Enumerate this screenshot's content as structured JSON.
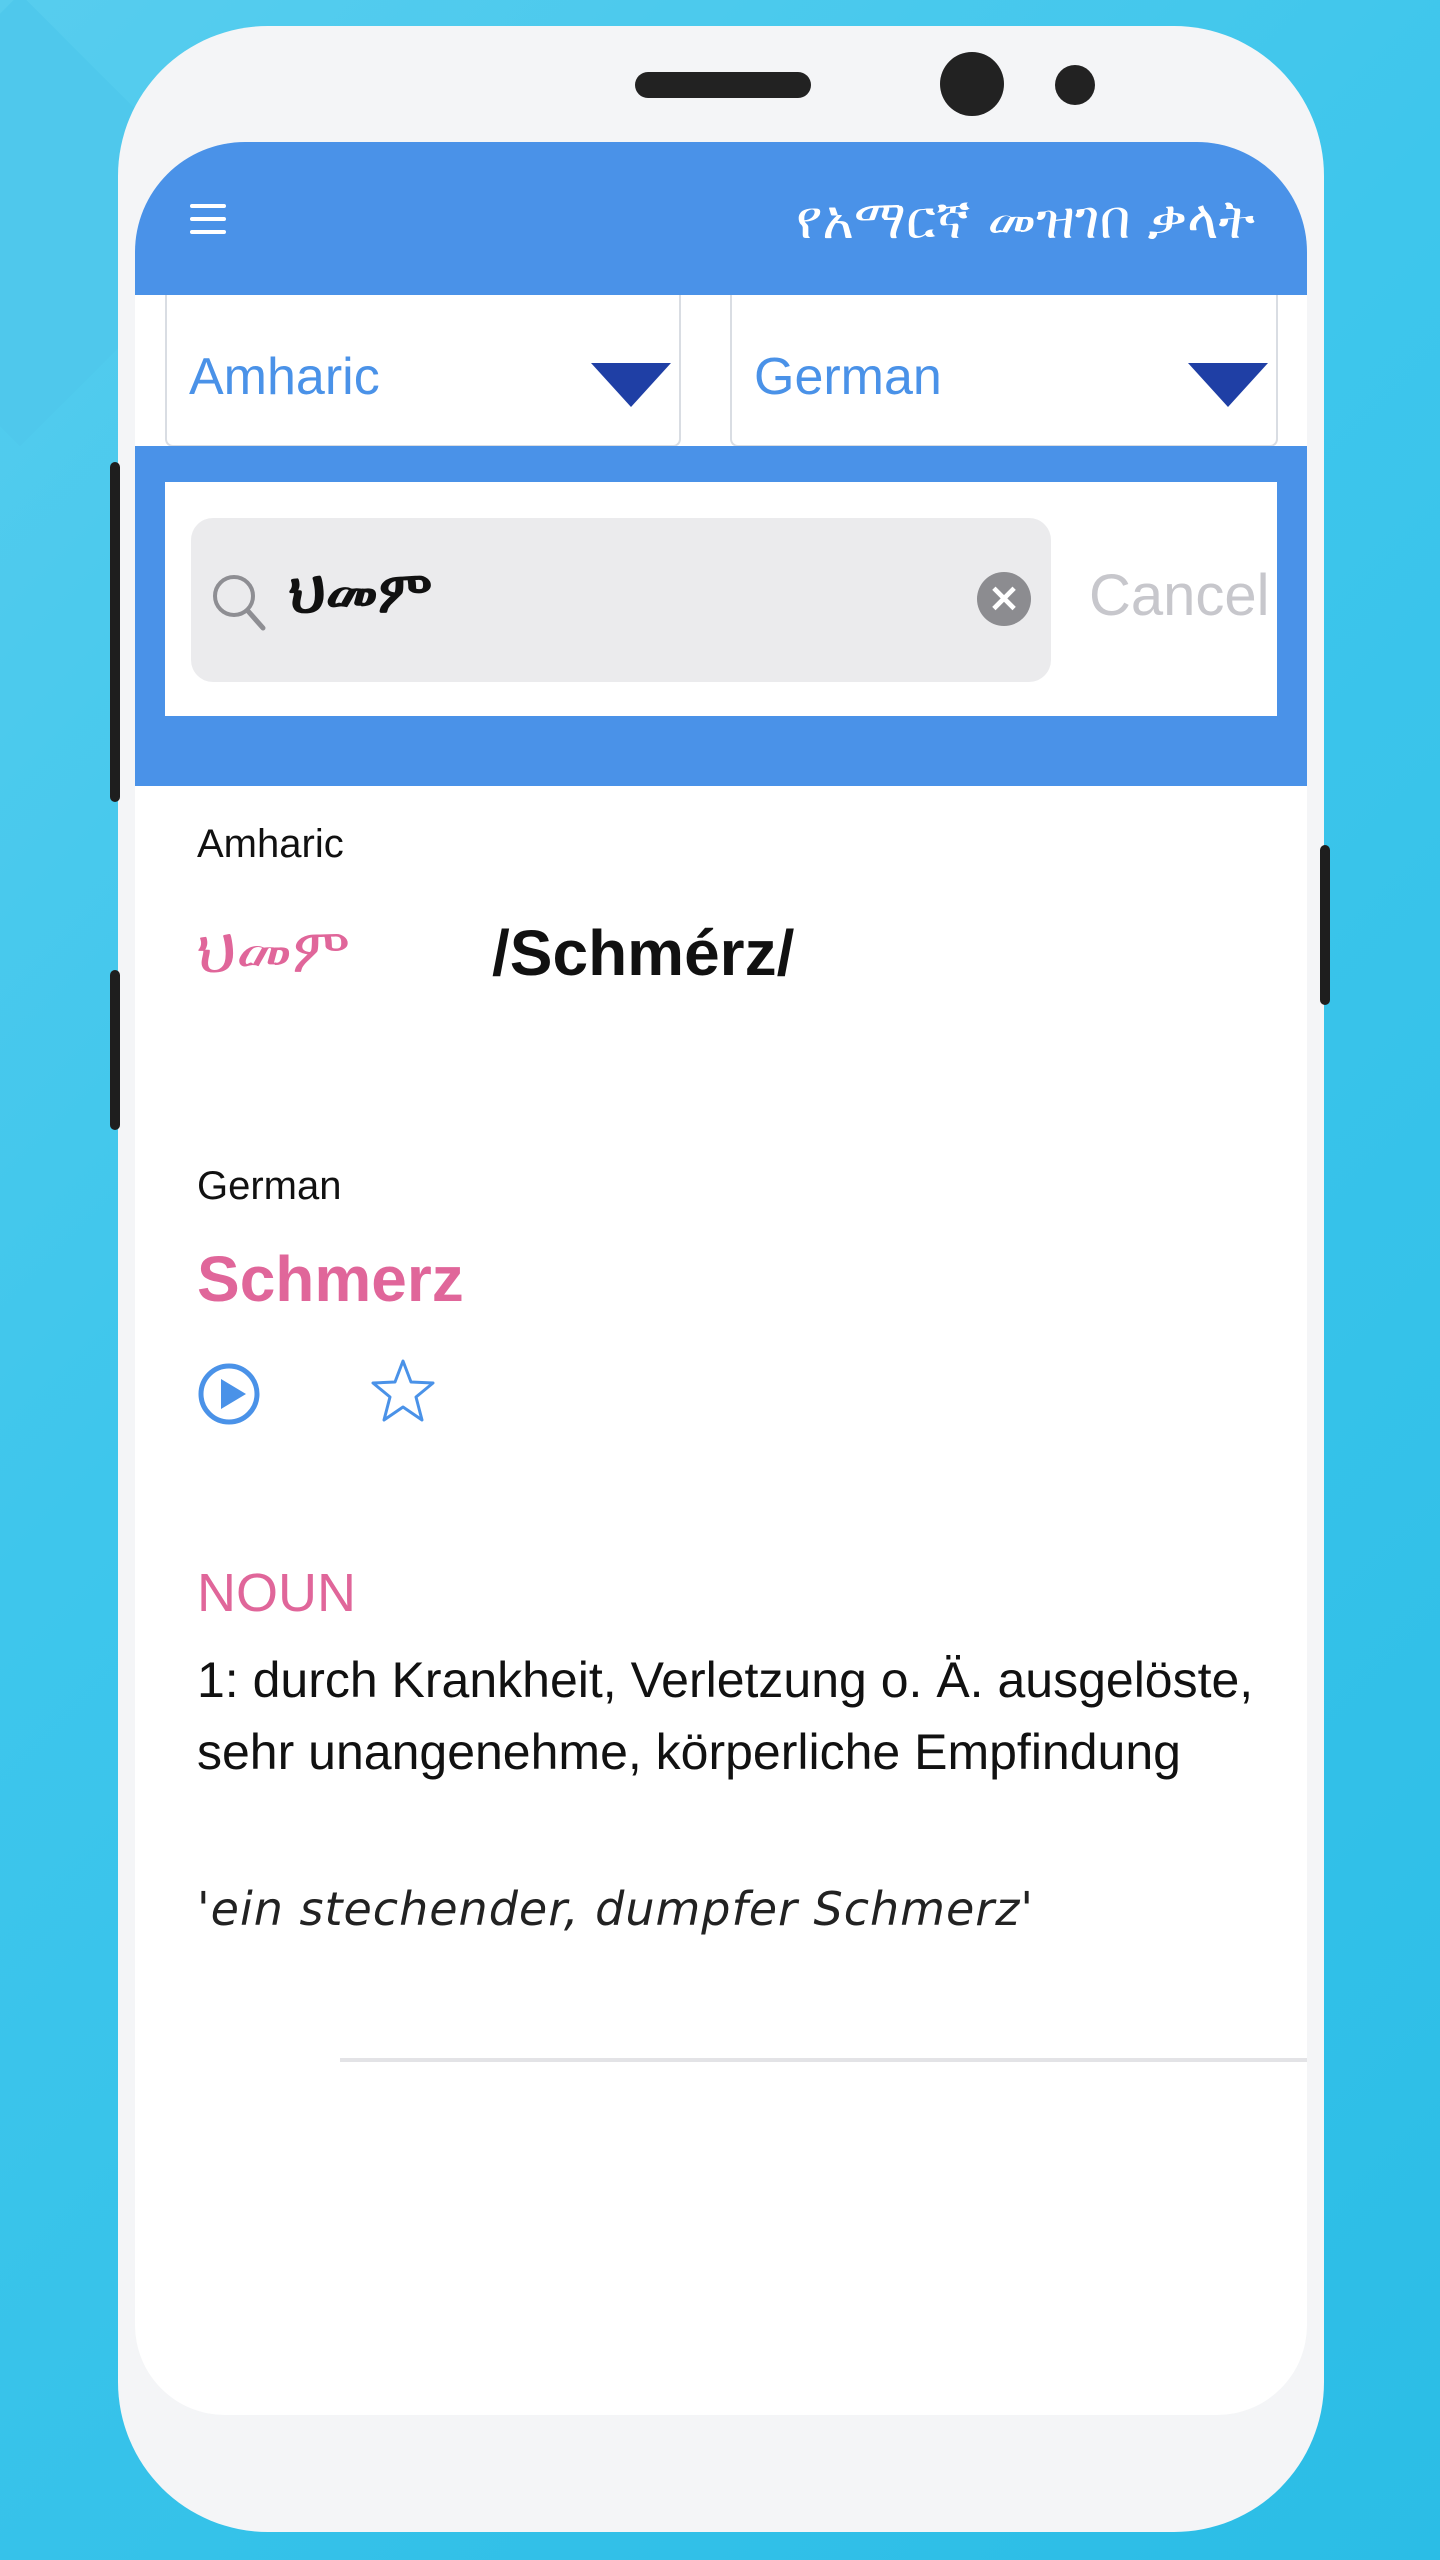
{
  "app": {
    "title": "የአማርኛ መዝገበ ቃላት"
  },
  "language_selector": {
    "source": "Amharic",
    "target": "German"
  },
  "search": {
    "query": "ህመም",
    "cancel_label": "Cancel"
  },
  "result": {
    "source_language": "Amharic",
    "source_word": "ህመም",
    "phonetic": "/Schmérz/",
    "target_language": "German",
    "target_word": "Schmerz",
    "part_of_speech": "NOUN",
    "definition": "1:  durch Krankheit, Verletzung o. Ä. ausgelöste, sehr unangenehme, körperliche Empfindung",
    "example": "'ein stechender, dumpfer Schmerz'"
  },
  "colors": {
    "accent_blue": "#4a92e8",
    "pink": "#e0669a",
    "dropdown_triangle": "#1f3fa5",
    "background": "#33c1e8"
  },
  "icons": [
    "menu-icon",
    "search-icon",
    "clear-icon",
    "play-icon",
    "star-icon",
    "dropdown-triangle-icon"
  ]
}
